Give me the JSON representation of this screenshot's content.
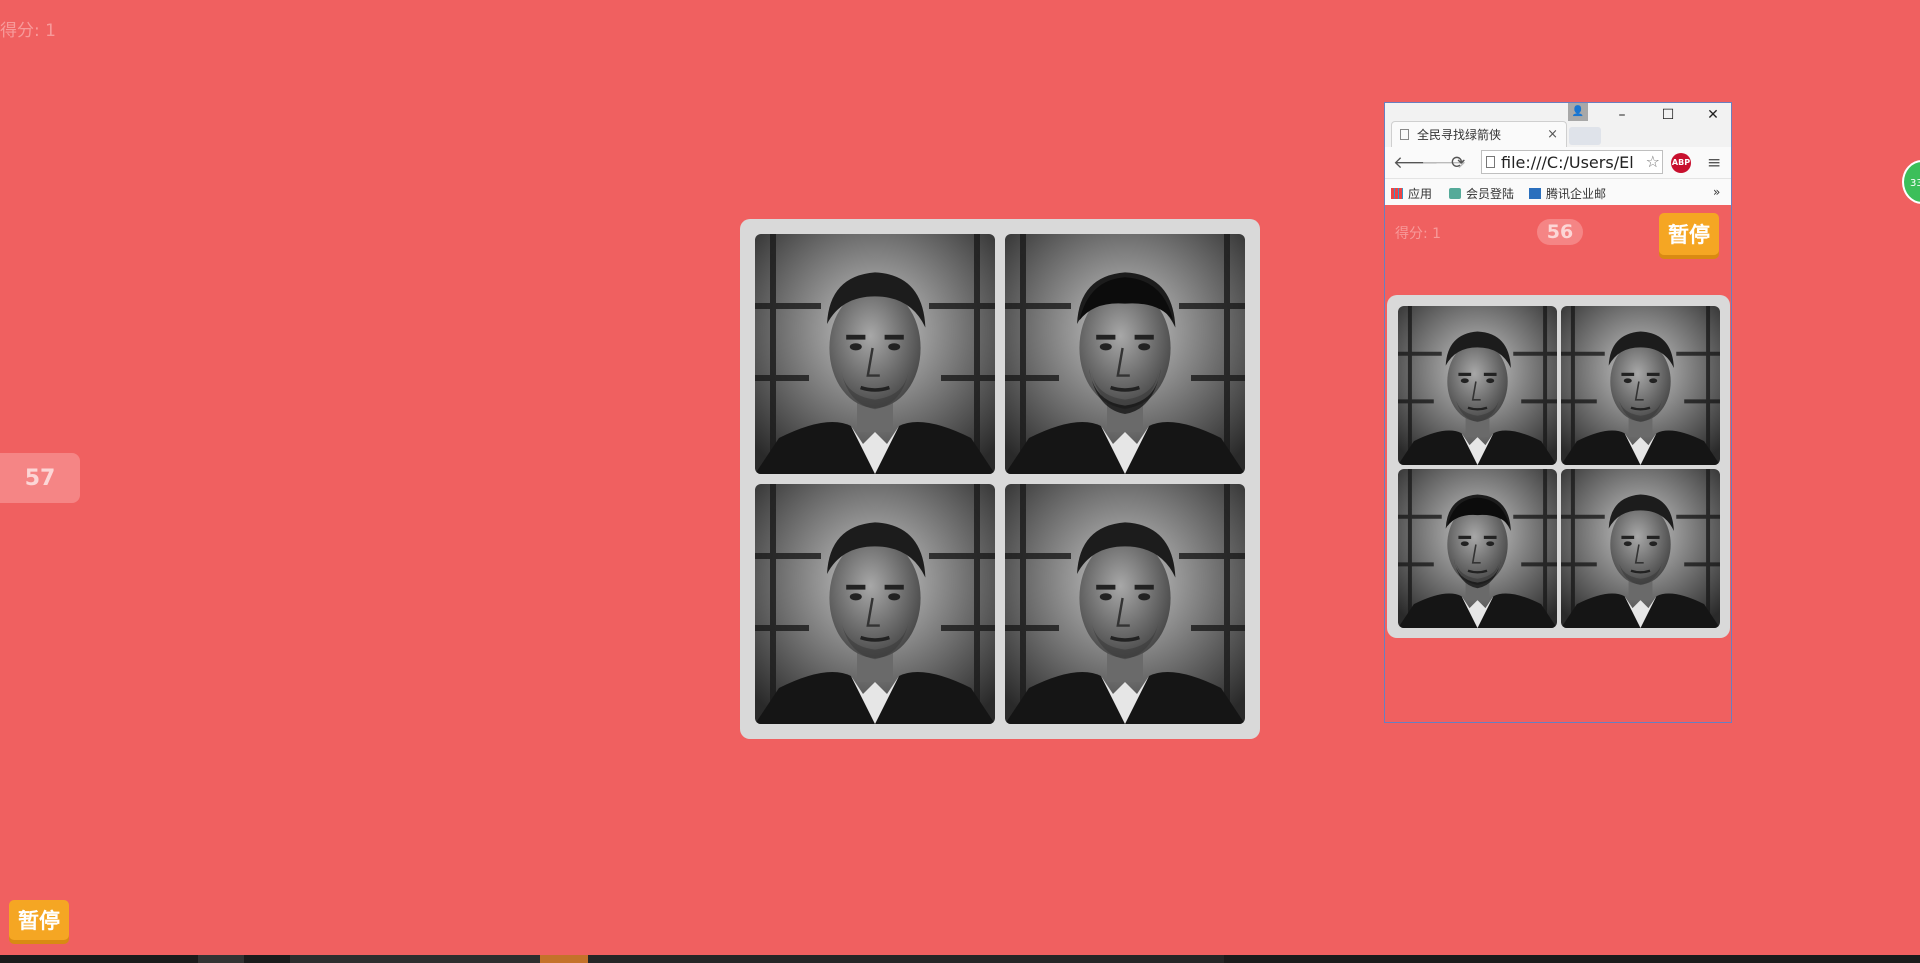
{
  "game": {
    "score_label": "得分: 1",
    "timer": "57",
    "pause_label": "暂停"
  },
  "browser": {
    "tab_title": "全民寻找绿箭侠",
    "tab_close": "×",
    "url": "file:///C:/Users/El",
    "abp_label": "ABP",
    "bookmarks": [
      "应用",
      "会员登陆",
      "腾讯企业邮"
    ],
    "bookmarks_more": "»",
    "window_controls": {
      "minimize": "–",
      "maximize": "☐",
      "close": "✕"
    }
  },
  "mini_game": {
    "score_label": "得分: 1",
    "timer": "56",
    "pause_label": "暂停"
  },
  "side_widget": "33",
  "colors": {
    "background": "#f06060",
    "board": "#d9d9d9",
    "accent_button": "#f5a623",
    "timer_pill": "#f58585"
  }
}
